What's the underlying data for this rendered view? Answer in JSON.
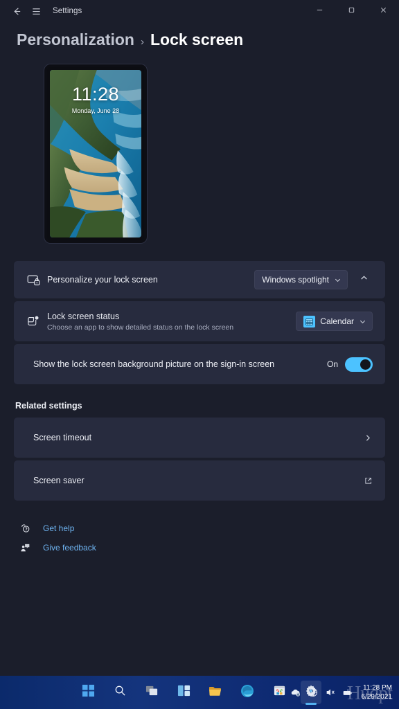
{
  "window": {
    "app_title": "Settings",
    "back_icon": "back-arrow-icon",
    "menu_icon": "hamburger-menu-icon",
    "minimize_label": "Minimize",
    "maximize_label": "Maximize",
    "close_label": "Close"
  },
  "breadcrumb": {
    "parent": "Personalization",
    "separator": "›",
    "current": "Lock screen"
  },
  "preview": {
    "time": "11:28",
    "date": "Monday, June 28",
    "image_name": "kelingking-beach-cliff-wallpaper"
  },
  "settings": {
    "personalize": {
      "title": "Personalize your lock screen",
      "icon": "lock-screen-icon",
      "dropdown_value": "Windows spotlight",
      "dropdown_chevron": "chevron-down-icon",
      "expander_chevron": "chevron-up-icon"
    },
    "status": {
      "title": "Lock screen status",
      "subtitle": "Choose an app to show detailed status on the lock screen",
      "icon": "status-badge-icon",
      "dropdown_value": "Calendar",
      "dropdown_app_icon": "calendar-icon",
      "dropdown_chevron": "chevron-down-icon"
    },
    "signin_picture": {
      "title": "Show the lock screen background picture on the sign-in screen",
      "toggle_state": "On",
      "toggle_color": "#4cc2ff"
    }
  },
  "related": {
    "heading": "Related settings",
    "items": [
      {
        "label": "Screen timeout",
        "action_icon": "chevron-right-icon"
      },
      {
        "label": "Screen saver",
        "action_icon": "external-link-icon"
      }
    ]
  },
  "help": {
    "get_help": "Get help",
    "get_help_icon": "question-help-icon",
    "give_feedback": "Give feedback",
    "give_feedback_icon": "feedback-icon",
    "link_color": "#6eb3f0"
  },
  "taskbar": {
    "items": [
      {
        "name": "start",
        "label": "Start"
      },
      {
        "name": "search",
        "label": "Search"
      },
      {
        "name": "task-view",
        "label": "Task view"
      },
      {
        "name": "widgets",
        "label": "Widgets"
      },
      {
        "name": "file-explorer",
        "label": "File Explorer"
      },
      {
        "name": "edge",
        "label": "Microsoft Edge"
      },
      {
        "name": "store",
        "label": "Microsoft Store"
      },
      {
        "name": "settings",
        "label": "Settings"
      }
    ],
    "tray": {
      "overflow_icon": "chevron-up-icon",
      "onedrive_icon": "cloud-icon",
      "network_icon": "network-globe-icon",
      "volume_icon": "speaker-muted-icon",
      "battery_icon": "battery-icon"
    },
    "clock": {
      "time": "11:28 PM",
      "date": "6/29/2021"
    }
  },
  "watermark": {
    "text": "Hudpt"
  }
}
